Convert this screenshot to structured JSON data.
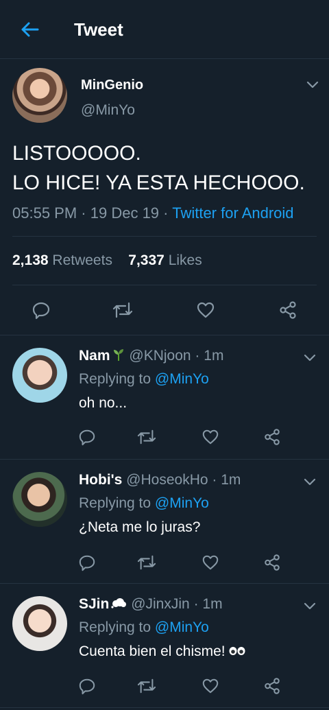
{
  "header": {
    "title": "Tweet"
  },
  "main_tweet": {
    "author_name": "MinGenio",
    "author_handle": "@MinYo",
    "text_line1": "LISTOOOOO.",
    "text_line2": "LO HICE! YA ESTA HECHOOO.",
    "time": "05:55 PM",
    "separator": "·",
    "date": "19 Dec 19",
    "source": "Twitter for Android",
    "retweets_count": "2,138",
    "retweets_label": "Retweets",
    "likes_count": "7,337",
    "likes_label": "Likes"
  },
  "replies": [
    {
      "name": "Nam",
      "name_emoji": "sprout",
      "handle": "@KNjoon",
      "age": "1m",
      "replying_prefix": "Replying to",
      "replying_to": "@MinYo",
      "text": "oh no...",
      "text_emoji": ""
    },
    {
      "name": "Hobi's",
      "name_emoji": "",
      "handle": "@HoseokHo",
      "age": "1m",
      "replying_prefix": "Replying to",
      "replying_to": "@MinYo",
      "text": "¿Neta me lo juras?",
      "text_emoji": ""
    },
    {
      "name": "SJin",
      "name_emoji": "cloud",
      "handle": "@JinxJin",
      "age": "1m",
      "replying_prefix": "Replying to",
      "replying_to": "@MinYo",
      "text": "Cuenta bien el chisme!",
      "text_emoji": "eyes"
    }
  ],
  "colors": {
    "background": "#15202b",
    "accent": "#1da1f2",
    "muted": "#8899a6",
    "divider": "#253341"
  },
  "icons": [
    "back-arrow-icon",
    "chevron-down-icon",
    "reply-icon",
    "retweet-icon",
    "like-icon",
    "share-icon"
  ]
}
